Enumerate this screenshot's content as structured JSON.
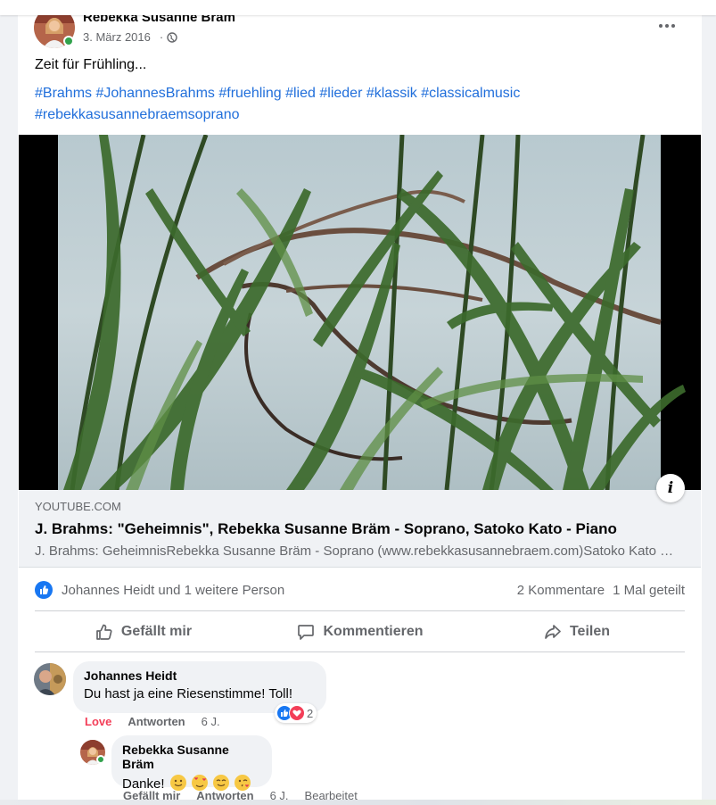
{
  "post": {
    "author": "Rebekka Susanne Bräm",
    "date": "3. März 2016",
    "separator": "·",
    "text": "Zeit für Frühling...",
    "hashtags": [
      "#Brahms",
      "#JohannesBrahms",
      "#fruehling",
      "#lied",
      "#lieder",
      "#klassik",
      "#classicalmusic",
      "#rebekkasusannebraemsoprano"
    ]
  },
  "link": {
    "domain": "YOUTUBE.COM",
    "title": "J. Brahms: \"Geheimnis\", Rebekka Susanne Bräm - Soprano, Satoko Kato - Piano",
    "description": "J. Brahms: GeheimnisRebekka Susanne Bräm - Soprano (www.rebekkasusannebraem.com)Satoko Kato - Piano",
    "info_label": "i"
  },
  "reactions": {
    "names": "Johannes Heidt und 1 weitere Person",
    "comments": "2 Kommentare",
    "shares": "1 Mal geteilt"
  },
  "actions": {
    "like": "Gefällt mir",
    "comment": "Kommentieren",
    "share": "Teilen"
  },
  "comments": [
    {
      "author": "Johannes Heidt",
      "text": "Du hast ja eine Riesenstimme! Toll!",
      "reaction_label": "Love",
      "reply": "Antworten",
      "time": "6 J.",
      "reaction_count": "2"
    },
    {
      "author": "Rebekka Susanne Bräm",
      "text": "Danke!",
      "like": "Gefällt mir",
      "reply": "Antworten",
      "time": "6 J.",
      "edited": "Bearbeitet"
    }
  ],
  "colors": {
    "link": "#216fdb",
    "like": "#1877f2",
    "love": "#f33e58",
    "online": "#31a24c"
  }
}
